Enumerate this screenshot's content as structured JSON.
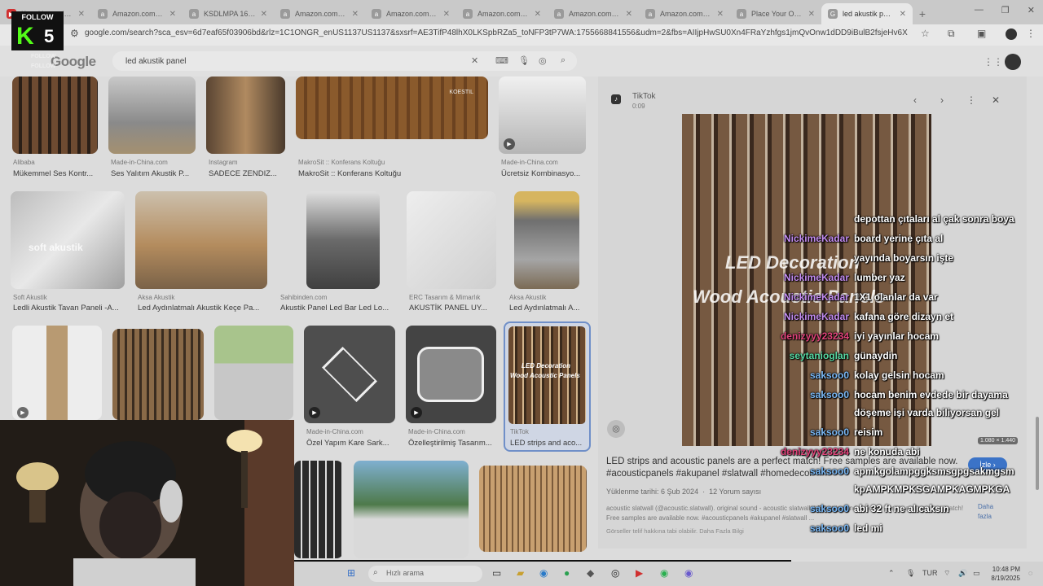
{
  "browser": {
    "tabs": [
      {
        "label": "Kanal kontrol pa..."
      },
      {
        "label": "Amazon.com Sho..."
      },
      {
        "label": "KSDLMPA 16.4Ft..."
      },
      {
        "label": "Amazon.com: UM..."
      },
      {
        "label": "Amazon.com Sho..."
      },
      {
        "label": "Amazon.com Sho..."
      },
      {
        "label": "Amazon.com: LEA..."
      },
      {
        "label": "Amazon.com Sho..."
      },
      {
        "label": "Place Your Order..."
      },
      {
        "label": "led akustik pane"
      }
    ],
    "url": "google.com/search?sca_esv=6d7eaf65f03906bd&rlz=1C1ONGR_enUS1137US1137&sxsrf=AE3TifP48lhX0LKSpbRZa5_toNFP3tP7WA:1755668841556&udm=2&fbs=AIIjpHwSU0Xn4FRaYzhfgs1jmQvOnw1dDD9iBulB2fsjeHv6XuKgDzU9KpxZMcpsjQ..."
  },
  "google": {
    "logo": "Google",
    "query": "led akustik panel"
  },
  "results": {
    "row1": [
      {
        "source": "Alibaba",
        "title": "Mükemmel Ses Kontr..."
      },
      {
        "source": "Made-in-China.com",
        "title": "Ses Yalıtım Akustik P..."
      },
      {
        "source": "Instagram",
        "title": "SADECE ZENDIZ..."
      },
      {
        "source": "MakroSit :: Konferans Koltuğu",
        "title": "MakroSit :: Konferans Koltuğu"
      },
      {
        "source": "Made-in-China.com",
        "title": "Ücretsiz Kombinasyo..."
      }
    ],
    "row2": [
      {
        "source": "Soft Akustik",
        "title": "Ledli Akustik Tavan Paneli -A..."
      },
      {
        "source": "Aksa Akustik",
        "title": "Led Aydınlatmalı Akustik Keçe Pa..."
      },
      {
        "source": "Sahibinden.com",
        "title": "Akustik Panel Led Bar Led Lo..."
      },
      {
        "source": "ERC Tasarım & Mimarlık",
        "title": "AKUSTİK PANEL UY..."
      },
      {
        "source": "Aksa Akustik",
        "title": "Led Aydınlatmalı A..."
      }
    ],
    "row3": [
      {
        "source": "Made-in-China.com",
        "title": "Özel Yapım Kare Sark..."
      },
      {
        "source": "Made-in-China.com",
        "title": "Özelleştirilmiş Tasarım..."
      },
      {
        "source": "TikTok",
        "title": "LED strips and aco..."
      }
    ],
    "thumb_texts": {
      "soft_akustik_watermark": "soft akustik",
      "tiktok_thumb_line1": "LED Decoration",
      "tiktok_thumb_line2": "Wood Acoustic Panels",
      "koestil_sign": "KOESTIL"
    }
  },
  "preview": {
    "source": "TikTok",
    "duration": "0:09",
    "image_text_line1": "LED Decoration",
    "image_text_line2": "Wood Acoustic Panels",
    "dimensions": "1.080 × 1.440",
    "title": "LED strips and acoustic panels are a perfect match! Free samples are available now. #acousticpanels #akupanel #slatwall #homedecor",
    "watch_button": "İzle",
    "upload_date": "Yüklenme tarihi: 6 Şub 2024",
    "comments": "12 Yorum sayısı",
    "description": "acoustic slatwall (@acoustic.slatwall). original sound - acoustic slatwall. LED strips and acoustic panels are a perfect match! Free samples are available now. #acousticpanels #akupanel #slatwall ...",
    "more": "Daha fazla",
    "copyright": "Görseller telif hakkına tabi olabilir. Daha Fazla Bilgi"
  },
  "chat": [
    {
      "user": "",
      "message": "depottan çıtaları al çak sonra boya",
      "user_color": "#ffffff"
    },
    {
      "user": "NickimeKadar",
      "message": "board yerine çıta al",
      "user_color": "#c38cf0"
    },
    {
      "user": "",
      "message": "yayında boyarsın işte",
      "user_color": "#ffffff"
    },
    {
      "user": "NickimeKadar",
      "message": "lumber yaz",
      "user_color": "#c38cf0"
    },
    {
      "user": "NickimeKadar",
      "message": "1X1 olanlar da var",
      "user_color": "#c38cf0"
    },
    {
      "user": "NickimeKadar",
      "message": "kafana göre dizayn et",
      "user_color": "#c38cf0"
    },
    {
      "user": "denizyyy23234",
      "message": "iyi yayınlar hocam",
      "user_color": "#e0437a"
    },
    {
      "user": "seytanioglan",
      "message": "günaydin",
      "user_color": "#57d9a3"
    },
    {
      "user": "saksoo0",
      "message": "kolay gelsin hocam",
      "user_color": "#7ab8f5"
    },
    {
      "user": "saksoo0",
      "message": "hocam benim evdede bir dayama",
      "user_color": "#7ab8f5"
    },
    {
      "user": "",
      "message": "döşeme işi varda biliyorsan gel",
      "user_color": "#ffffff"
    },
    {
      "user": "saksoo0",
      "message": "reisim",
      "user_color": "#7ab8f5"
    },
    {
      "user": "denizyyy23234",
      "message": "ne konuda abi",
      "user_color": "#e0437a"
    },
    {
      "user": "saksoo0",
      "message": "apmkgolampggksmsgpgsakmgsm",
      "user_color": "#7ab8f5"
    },
    {
      "user": "",
      "message": "kpAMPKMPKSGAMPKAGMPKGA",
      "user_color": "#ffffff"
    },
    {
      "user": "saksoo0",
      "message": "abi 32 ft ne alıcaksın",
      "user_color": "#7ab8f5"
    },
    {
      "user": "saksoo0",
      "message": "led mi",
      "user_color": "#7ab8f5"
    }
  ],
  "overlay": {
    "follow_label": "FOLLOW",
    "logo_letter": "K",
    "logo_number": "5"
  },
  "taskbar": {
    "search_placeholder": "Hızlı arama",
    "language": "TUR",
    "time": "10:48 PM",
    "date": "8/19/2025"
  },
  "colors": {
    "accent": "#3b73c7",
    "kick_green": "#53fc18"
  }
}
